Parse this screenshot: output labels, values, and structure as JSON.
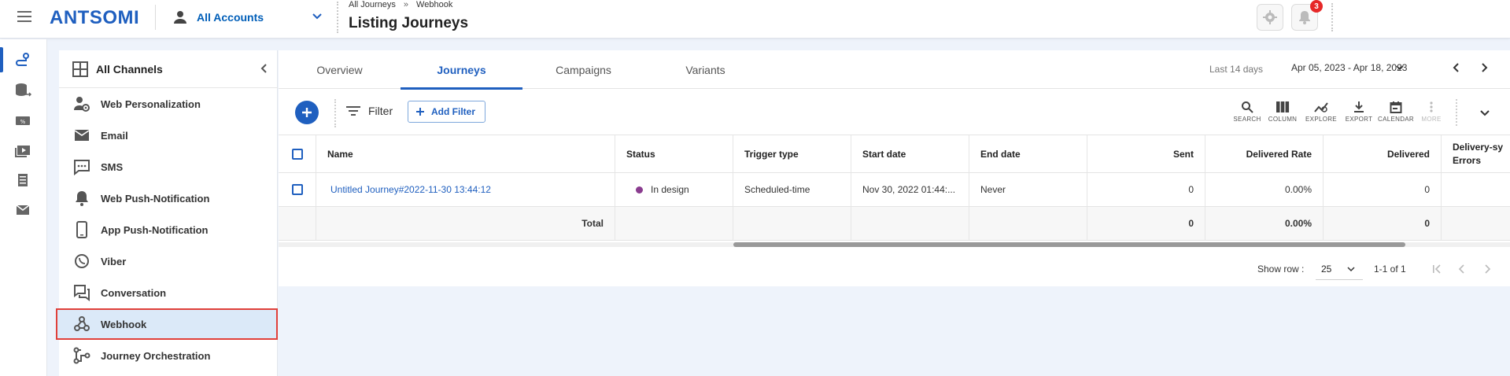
{
  "topbar": {
    "logo": "ANTSOMI",
    "account": "All Accounts",
    "breadcrumb": [
      "All Journeys",
      "Webhook"
    ],
    "breadcrumb_sep": "»",
    "title": "Listing Journeys",
    "notification_count": "3"
  },
  "rail": {
    "icons": [
      "journey-icon",
      "data-icon",
      "ticket-icon",
      "media-icon",
      "catalog-icon",
      "mail-icon"
    ]
  },
  "channels": {
    "header": "All Channels",
    "items": [
      {
        "label": "Web Personalization",
        "icon": "web-personalization-icon"
      },
      {
        "label": "Email",
        "icon": "email-icon"
      },
      {
        "label": "SMS",
        "icon": "sms-icon"
      },
      {
        "label": "Web Push-Notification",
        "icon": "bell-icon"
      },
      {
        "label": "App Push-Notification",
        "icon": "mobile-icon"
      },
      {
        "label": "Viber",
        "icon": "viber-icon"
      },
      {
        "label": "Conversation",
        "icon": "conversation-icon"
      },
      {
        "label": "Webhook",
        "icon": "webhook-icon",
        "selected": true
      },
      {
        "label": "Journey Orchestration",
        "icon": "orchestration-icon"
      }
    ]
  },
  "tabs": [
    "Overview",
    "Journeys",
    "Campaigns",
    "Variants"
  ],
  "active_tab": "Journeys",
  "date": {
    "label": "Last 14 days",
    "range": "Apr 05, 2023 - Apr 18, 2023"
  },
  "toolbar": {
    "filter_label": "Filter",
    "add_filter_label": "Add Filter",
    "tools": [
      "SEARCH",
      "COLUMN",
      "EXPLORE",
      "EXPORT",
      "CALENDAR",
      "MORE"
    ]
  },
  "table": {
    "columns": [
      "Name",
      "Status",
      "Trigger type",
      "Start date",
      "End date",
      "Sent",
      "Delivered Rate",
      "Delivered",
      "Delivery-sy Errors"
    ],
    "rows": [
      {
        "name": "Untitled Journey#2022-11-30 13:44:12",
        "status": "In design",
        "status_color": "#8a3c8f",
        "trigger": "Scheduled-time",
        "start": "Nov 30, 2022 01:44:...",
        "end": "Never",
        "sent": "0",
        "delivered_rate": "0.00%",
        "delivered": "0"
      }
    ],
    "total": {
      "label": "Total",
      "sent": "0",
      "delivered_rate": "0.00%",
      "delivered": "0"
    }
  },
  "pagination": {
    "show_row_label": "Show row :",
    "rows_per_page": "25",
    "range": "1-1 of 1"
  },
  "colors": {
    "accent": "#1f5fbf",
    "highlight_border": "#e0403a",
    "badge": "#e62828"
  }
}
